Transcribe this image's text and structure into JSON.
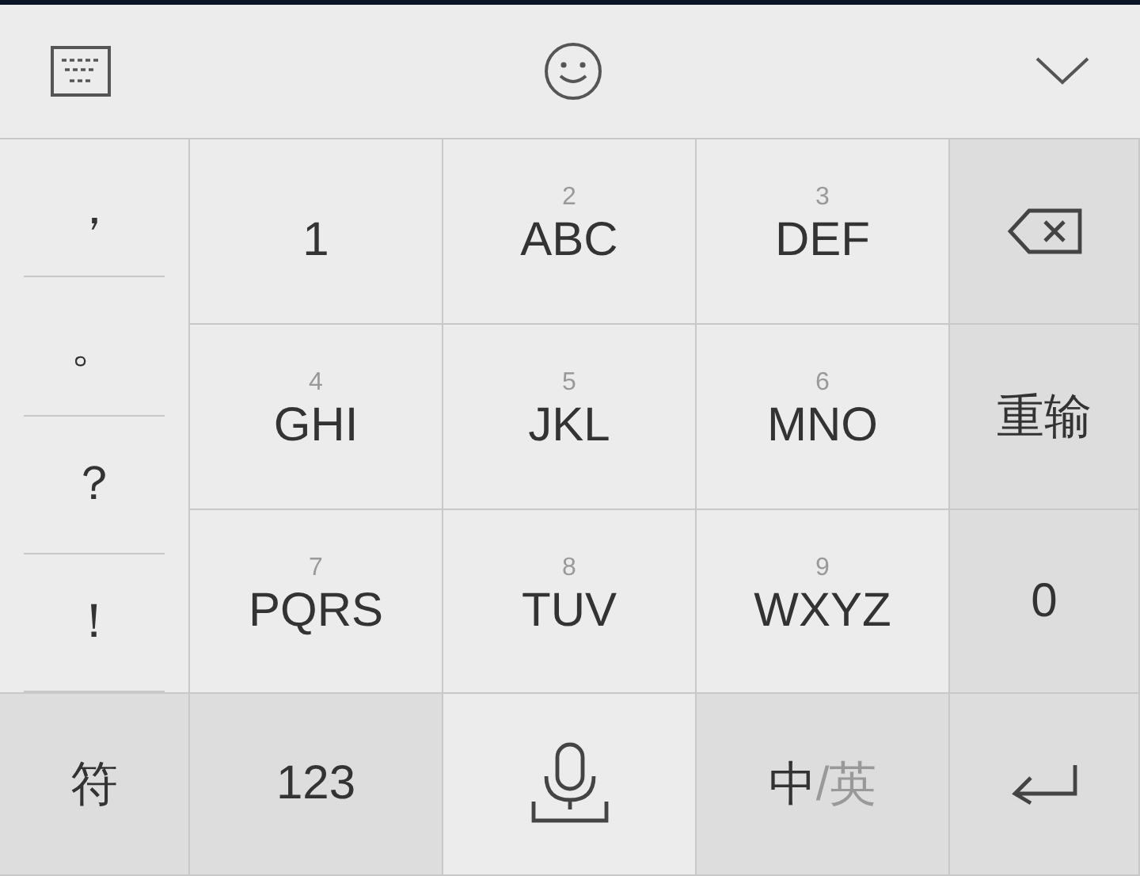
{
  "toolbar": [
    {
      "kind": "keyboard"
    },
    {
      "kind": "emoji"
    },
    {
      "kind": "collapse"
    }
  ],
  "punctuation": [
    "，",
    "。",
    "？",
    "！"
  ],
  "key_rows": [
    {
      "keys": [
        {
          "label": "1"
        },
        {
          "hint": "2",
          "label": "ABC"
        },
        {
          "hint": "3",
          "label": "DEF"
        }
      ]
    },
    {
      "keys": [
        {
          "hint": "4",
          "label": "GHI"
        },
        {
          "hint": "5",
          "label": "JKL"
        },
        {
          "hint": "6",
          "label": "MNO"
        }
      ]
    },
    {
      "keys": [
        {
          "hint": "7",
          "label": "PQRS"
        },
        {
          "hint": "8",
          "label": "TUV"
        },
        {
          "hint": "9",
          "label": "WXYZ"
        }
      ]
    }
  ],
  "side_keys": [
    {
      "kind": "backspace"
    },
    {
      "kind": "text",
      "label": "重输"
    },
    {
      "kind": "text",
      "label": "0"
    }
  ],
  "bottom_keys": [
    {
      "kind": "text",
      "label": "符"
    },
    {
      "kind": "text",
      "label": "123"
    },
    {
      "kind": "mic"
    },
    {
      "kind": "language",
      "options": [
        {
          "text": "中",
          "selected": true
        },
        {
          "text": "/英",
          "selected": false
        }
      ]
    },
    {
      "kind": "enter"
    }
  ]
}
